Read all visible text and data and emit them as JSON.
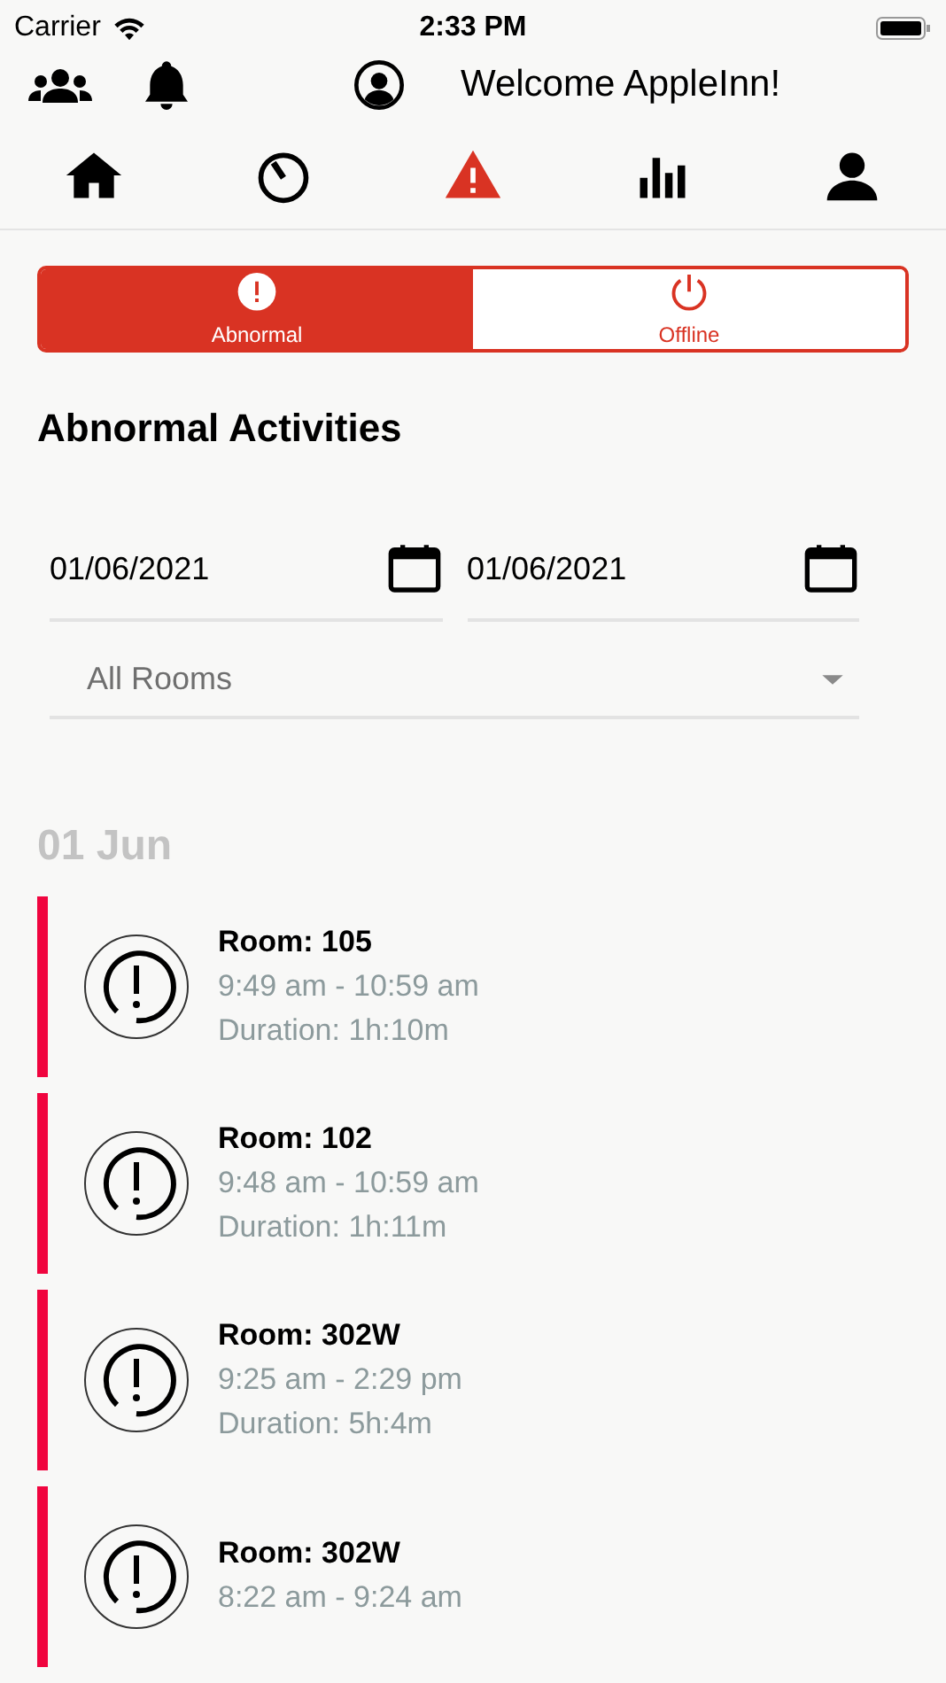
{
  "status_bar": {
    "carrier": "Carrier",
    "time": "2:33 PM"
  },
  "header": {
    "welcome": "Welcome AppleInn!"
  },
  "nav": [
    {
      "kind": "home",
      "selected": false
    },
    {
      "kind": "timer",
      "selected": false
    },
    {
      "kind": "alert",
      "selected": true
    },
    {
      "kind": "chart",
      "selected": false
    },
    {
      "kind": "user",
      "selected": false
    }
  ],
  "segments": [
    {
      "kind": "abnormal",
      "label": "Abnormal",
      "selected": true
    },
    {
      "kind": "offline",
      "label": "Offline",
      "selected": false
    }
  ],
  "title": "Abnormal Activities",
  "dates": [
    {
      "value": "01/06/2021"
    },
    {
      "value": "01/06/2021"
    }
  ],
  "room_filter": {
    "value": "All Rooms"
  },
  "date_header": "01 Jun",
  "activities": [
    {
      "room": "Room: 105",
      "time": "9:49 am - 10:59 am",
      "duration": "Duration: 1h:10m"
    },
    {
      "room": "Room: 102",
      "time": "9:48 am - 10:59 am",
      "duration": "Duration: 1h:11m"
    },
    {
      "room": "Room: 302W",
      "time": "9:25 am - 2:29 pm",
      "duration": "Duration: 5h:4m"
    },
    {
      "room": "Room: 302W",
      "time": "8:22 am - 9:24 am"
    }
  ]
}
